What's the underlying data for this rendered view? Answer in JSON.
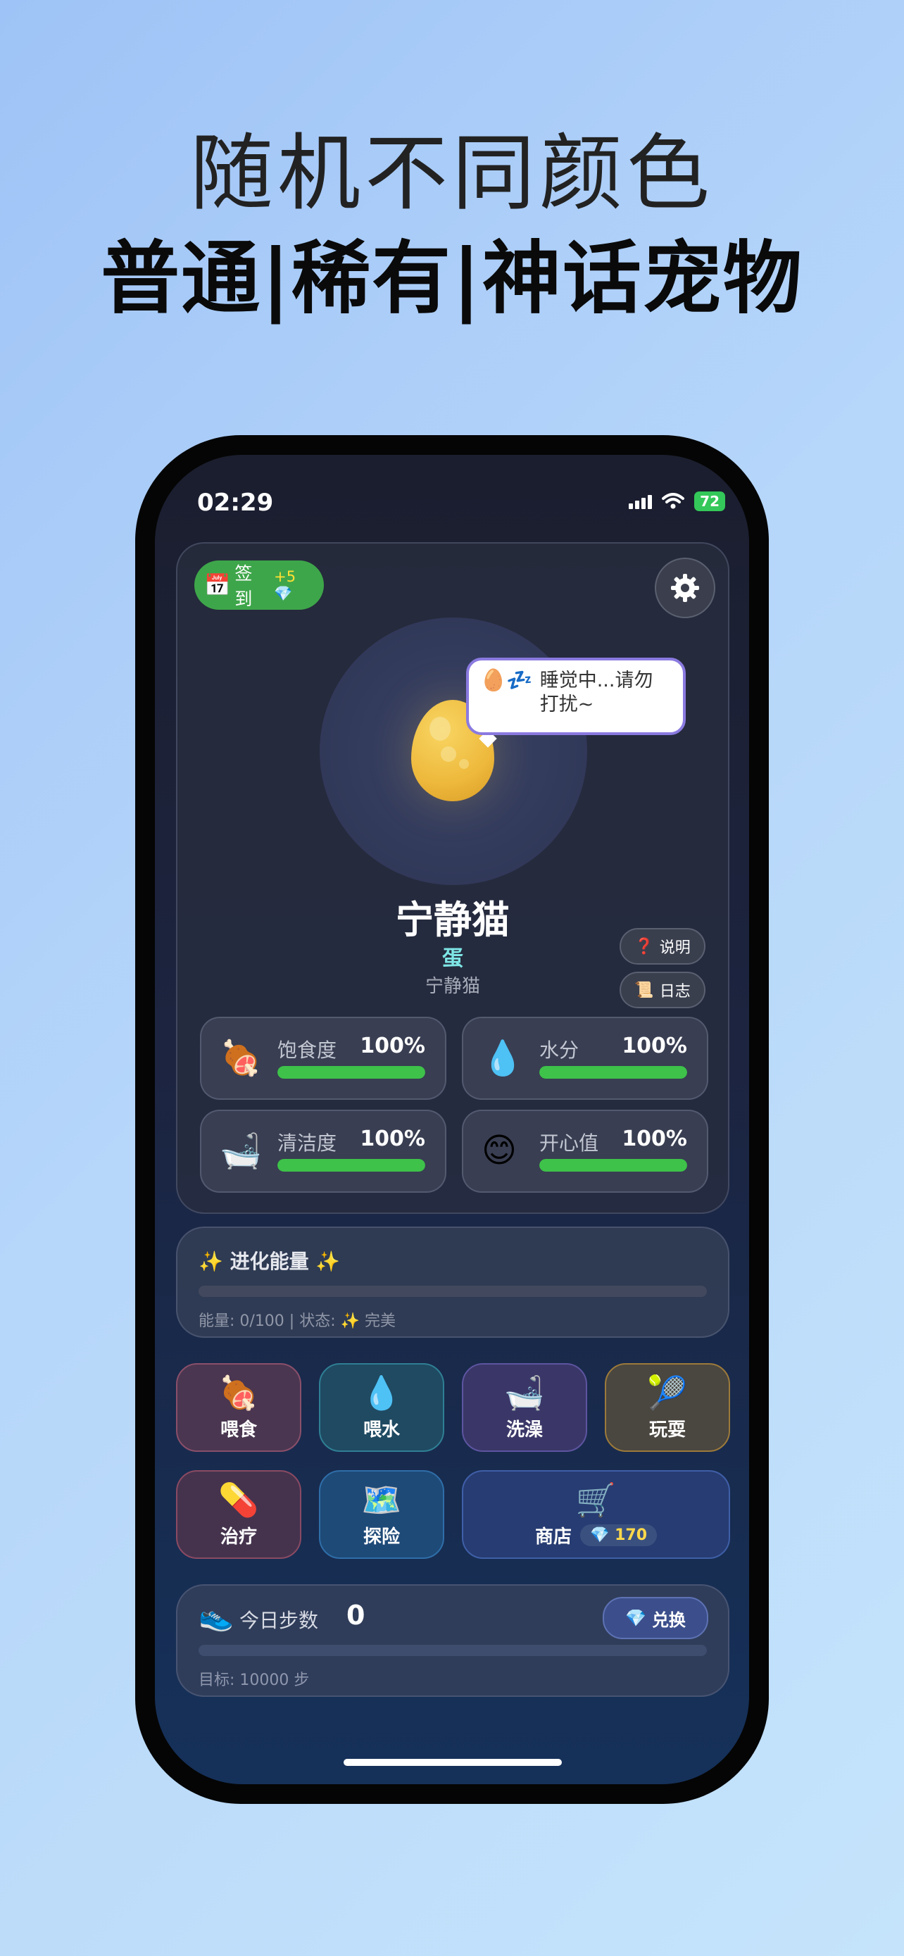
{
  "promo": {
    "line1": "随机不同颜色",
    "line2": "普通|稀有|神话宠物"
  },
  "status_bar": {
    "time": "02:29",
    "battery": "72"
  },
  "header": {
    "checkin_icon": "📅",
    "checkin_label": "签到",
    "checkin_reward": "+5💎",
    "settings_icon": "gear-icon"
  },
  "pet": {
    "bubble_icon": "🥚💤",
    "bubble_text": "睡觉中...请勿打扰~",
    "name": "宁静猫",
    "stage": "蛋",
    "species": "宁静猫",
    "help_icon": "❓",
    "help_label": "说明",
    "log_icon": "📜",
    "log_label": "日志"
  },
  "stats": [
    {
      "icon": "🍖",
      "label": "饱食度",
      "value": "100%",
      "level": 1.0
    },
    {
      "icon": "💧",
      "label": "水分",
      "value": "100%",
      "level": 1.0
    },
    {
      "icon": "🛁",
      "label": "清洁度",
      "value": "100%",
      "level": 1.0
    },
    {
      "icon": "😊",
      "label": "开心值",
      "value": "100%",
      "level": 1.0
    }
  ],
  "evolution": {
    "title": "✨ 进化能量 ✨",
    "info": "能量: 0/100 | 状态: ✨ 完美",
    "level": 0.0
  },
  "actions": [
    {
      "icon": "🍖",
      "label": "喂食",
      "bg": "#4a3650",
      "border": "#8a4f6a"
    },
    {
      "icon": "💧",
      "label": "喂水",
      "bg": "#1f4a62",
      "border": "#2f7f94"
    },
    {
      "icon": "🛁",
      "label": "洗澡",
      "bg": "#3a3768",
      "border": "#5d54a0"
    },
    {
      "icon": "🎾",
      "label": "玩耍",
      "bg": "#4a4640",
      "border": "#9c7a3a"
    },
    {
      "icon": "💊",
      "label": "治疗",
      "bg": "#45334e",
      "border": "#8a4a62"
    },
    {
      "icon": "🗺️",
      "label": "探险",
      "bg": "#1e4a78",
      "border": "#2f6ea8"
    }
  ],
  "shop": {
    "icon": "🛒",
    "label": "商店",
    "gem_icon": "💎",
    "gems": "170"
  },
  "steps": {
    "icon": "👟",
    "label": "今日步数",
    "value": "0",
    "exchange_icon": "💎",
    "exchange_label": "兑换",
    "goal": "目标: 10000 步",
    "level": 0.0
  }
}
